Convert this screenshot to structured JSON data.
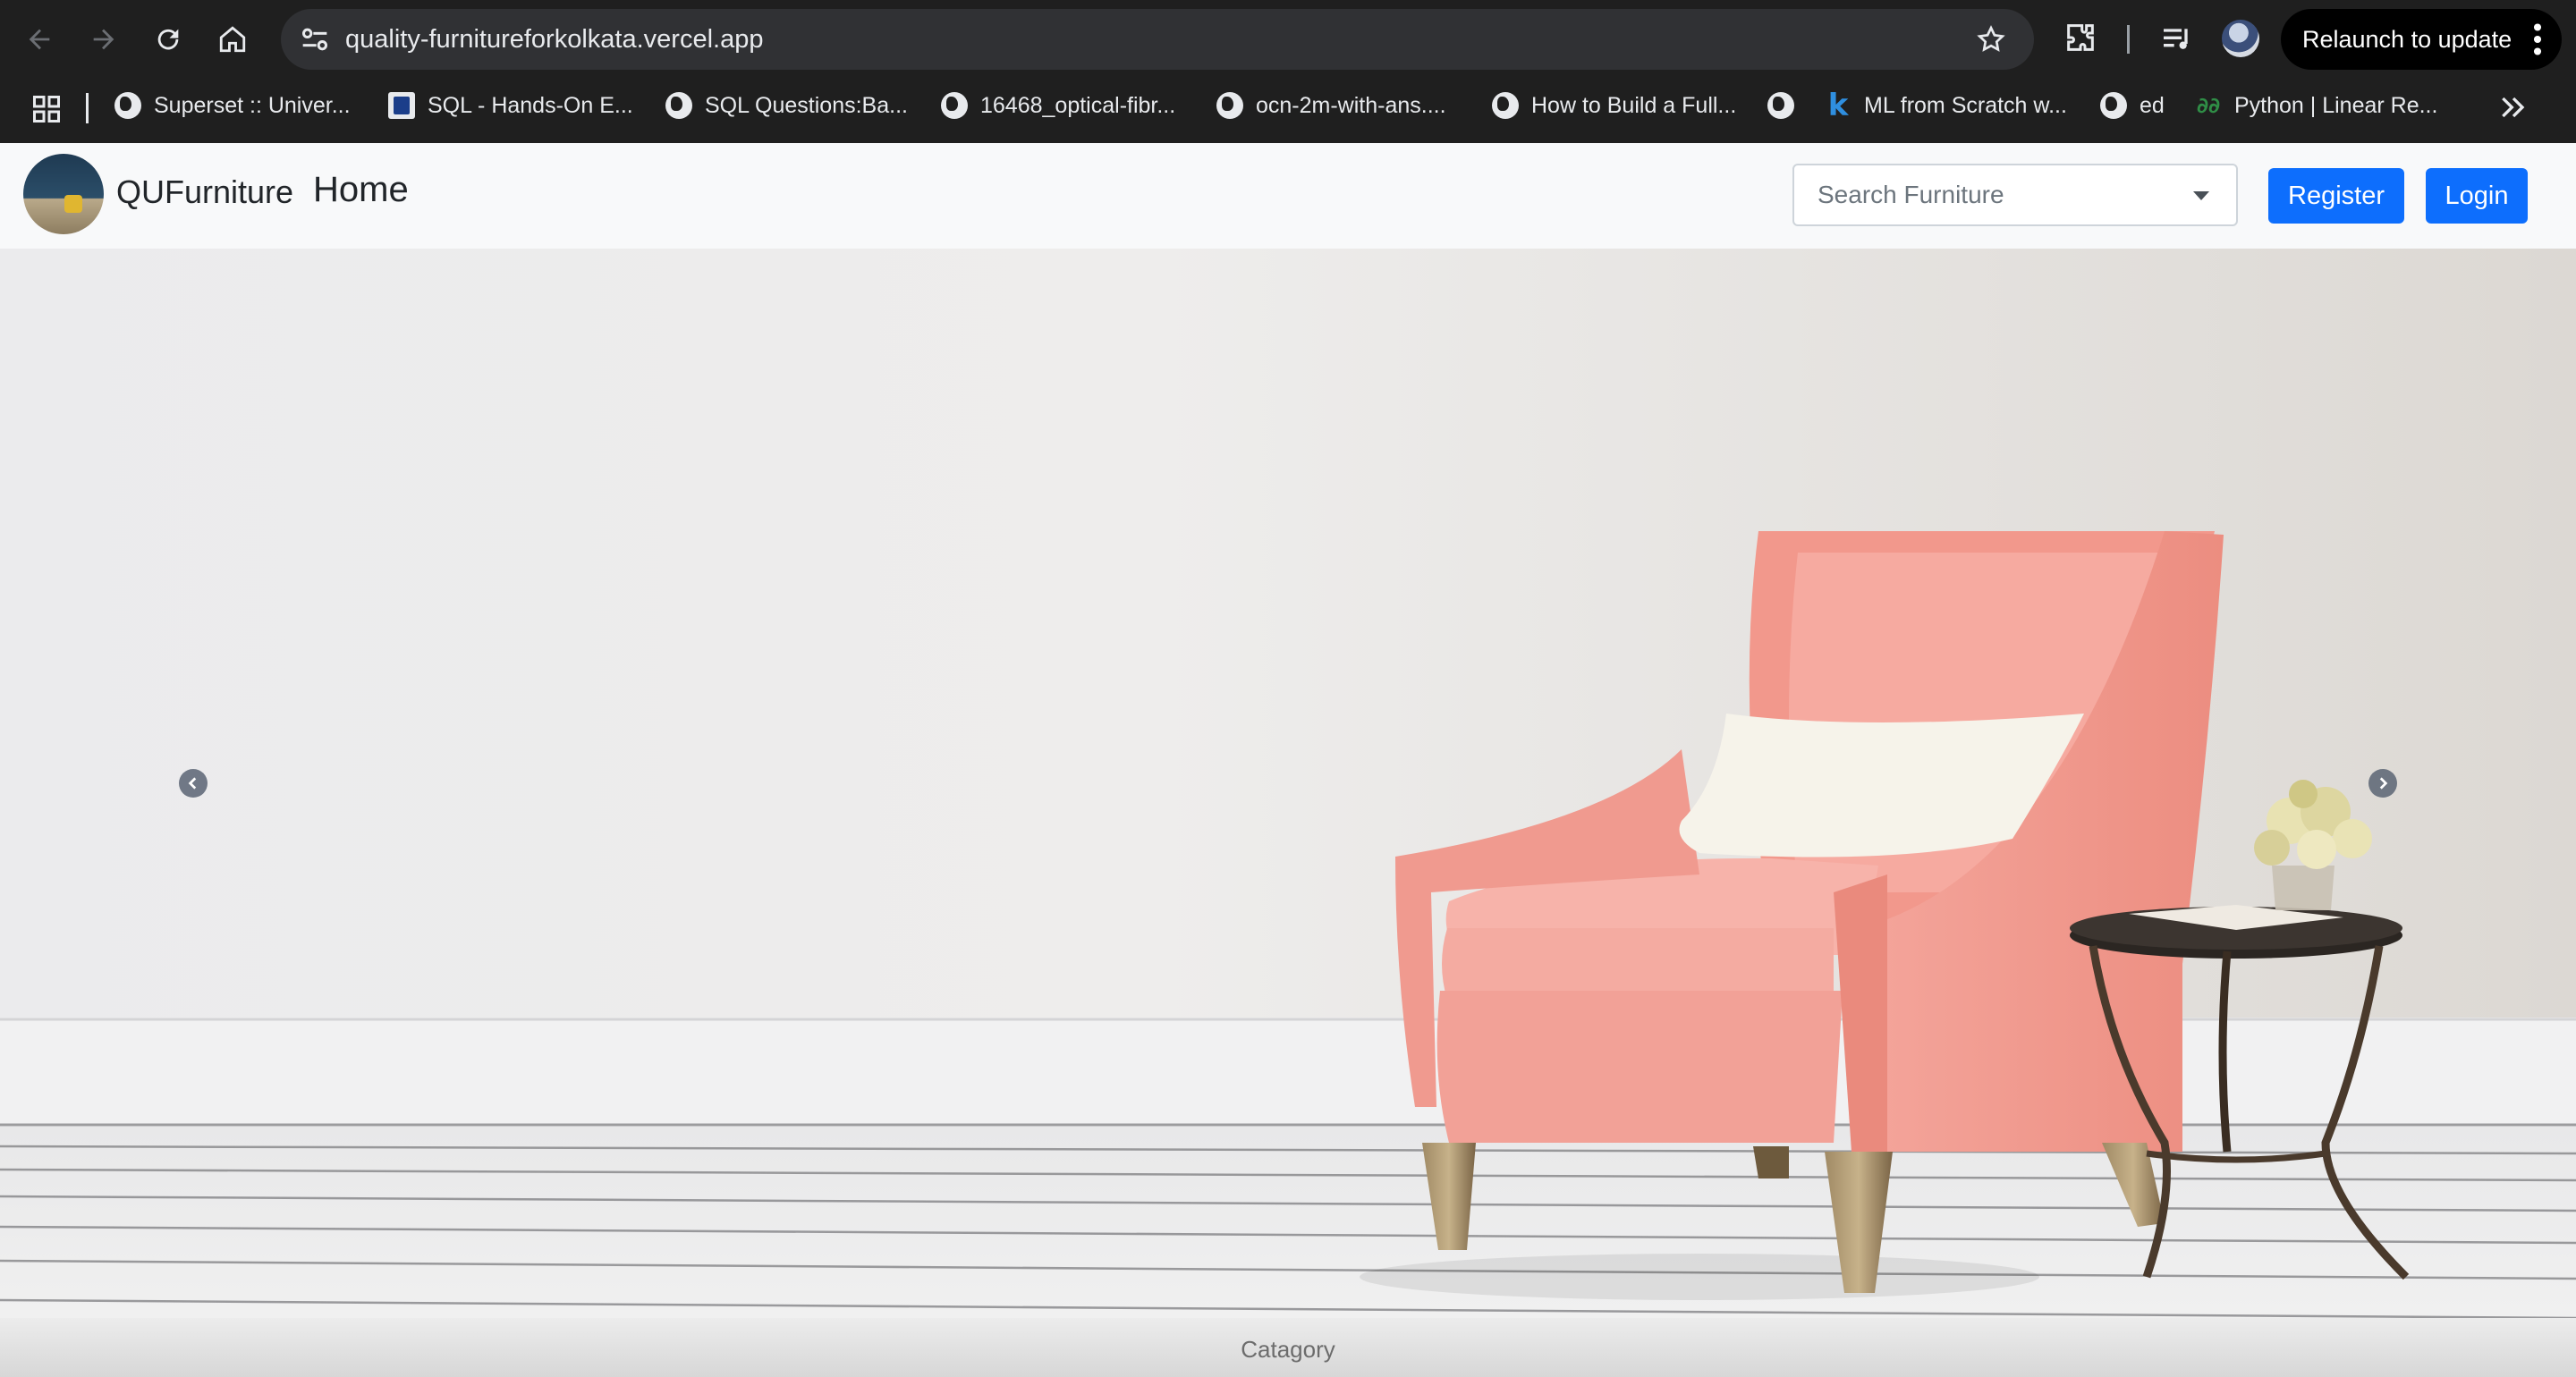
{
  "browser": {
    "url": "quality-furnitureforkolkata.vercel.app",
    "relaunch_label": "Relaunch to update",
    "bookmarks": [
      {
        "label": "Superset :: Univer...",
        "icon": "globe-icon"
      },
      {
        "label": "SQL - Hands-On E...",
        "icon": "site-favicon"
      },
      {
        "label": "SQL Questions:Ba...",
        "icon": "globe-icon"
      },
      {
        "label": "16468_optical-fibr...",
        "icon": "globe-icon"
      },
      {
        "label": "ocn-2m-with-ans....",
        "icon": "globe-icon"
      },
      {
        "label": "How to Build a Full...",
        "icon": "globe-icon"
      },
      {
        "label": "",
        "icon": "globe-icon"
      },
      {
        "label": "ML from Scratch w...",
        "icon": "k-icon"
      },
      {
        "label": "ed",
        "icon": "globe-icon"
      },
      {
        "label": "Python | Linear Re...",
        "icon": "geeks-icon"
      }
    ]
  },
  "site": {
    "brand": "QUFurniture",
    "nav_home": "Home",
    "search_placeholder": "Search Furniture",
    "register_label": "Register",
    "login_label": "Login",
    "category_label": "Catagory"
  },
  "colors": {
    "primary_button": "#0d6efd",
    "chrome_bg": "#1f1f1f",
    "armchair": "#f29b92"
  }
}
